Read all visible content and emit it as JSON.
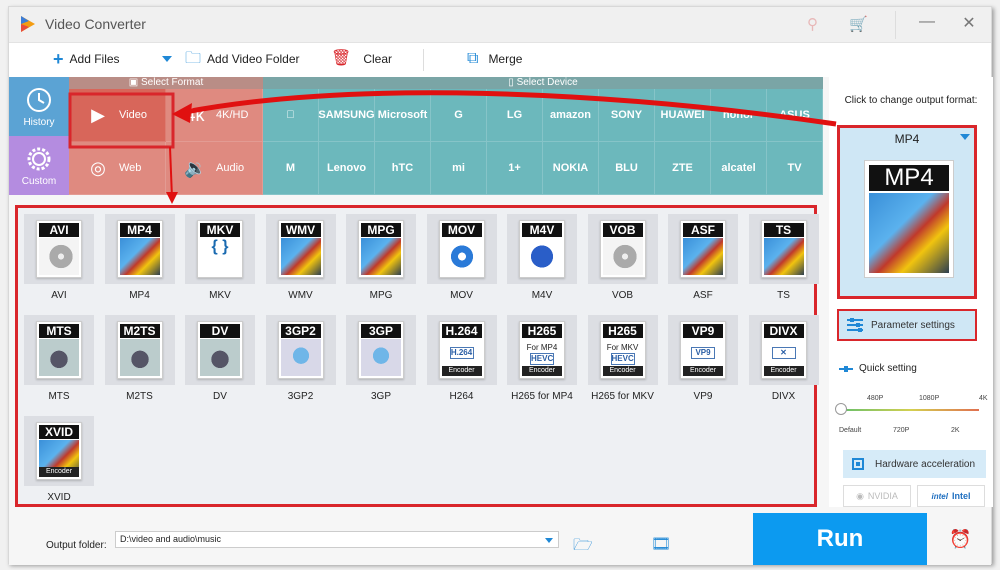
{
  "window": {
    "title": "Video Converter",
    "controls": {
      "minimize": "—",
      "close": "✕"
    },
    "title_icons": [
      {
        "name": "key-icon",
        "glyph": "⚷"
      },
      {
        "name": "cart-icon",
        "glyph": "⧢"
      }
    ]
  },
  "toolbar": {
    "add_files": "Add Files",
    "add_video_folder": "Add Video Folder",
    "clear": "Clear",
    "merge": "Merge"
  },
  "side": {
    "history": "History",
    "custom": "Custom"
  },
  "format_panel": {
    "header": "Select Format",
    "categories": [
      {
        "label": "Video",
        "icon": "play-icon",
        "glyph": "▶",
        "active": true
      },
      {
        "label": "4K/HD",
        "icon": "4k-icon",
        "glyph": "4k"
      },
      {
        "label": "Web",
        "icon": "chrome-icon",
        "glyph": "◎"
      },
      {
        "label": "Audio",
        "icon": "speaker-icon",
        "glyph": "🔉"
      }
    ]
  },
  "device_panel": {
    "header": "Select Device",
    "row1": [
      "",
      "SAMSUNG",
      "Microsoft",
      "G",
      "LG",
      "amazon",
      "SONY",
      "HUAWEI",
      "honor",
      "ASUS"
    ],
    "row1_names": [
      "apple",
      "samsung",
      "microsoft",
      "google",
      "lg",
      "amazon",
      "sony",
      "huawei",
      "honor",
      "asus"
    ],
    "row2": [
      "M",
      "Lenovo",
      "hTC",
      "mi",
      "1+",
      "NOKIA",
      "BLU",
      "ZTE",
      "alcatel",
      "TV"
    ],
    "row2_names": [
      "motorola",
      "lenovo",
      "htc",
      "xiaomi",
      "oneplus",
      "nokia",
      "blu",
      "zte",
      "alcatel",
      "tv"
    ]
  },
  "formats": [
    {
      "label": "AVI",
      "tag": "AVI",
      "art": "disc"
    },
    {
      "label": "MP4",
      "tag": "MP4",
      "art": "film"
    },
    {
      "label": "MKV",
      "tag": "MKV",
      "art": "mkv"
    },
    {
      "label": "WMV",
      "tag": "WMV",
      "art": "film"
    },
    {
      "label": "MPG",
      "tag": "MPG",
      "art": "film"
    },
    {
      "label": "MOV",
      "tag": "MOV",
      "art": "qt"
    },
    {
      "label": "M4V",
      "tag": "M4V",
      "art": "itunes"
    },
    {
      "label": "VOB",
      "tag": "VOB",
      "art": "disc"
    },
    {
      "label": "ASF",
      "tag": "ASF",
      "art": "film"
    },
    {
      "label": "TS",
      "tag": "TS",
      "art": "film"
    },
    {
      "label": "MTS",
      "tag": "MTS",
      "art": "cam"
    },
    {
      "label": "M2TS",
      "tag": "M2TS",
      "art": "cam"
    },
    {
      "label": "DV",
      "tag": "DV",
      "art": "cam"
    },
    {
      "label": "3GP2",
      "tag": "3GP2",
      "art": "phone"
    },
    {
      "label": "3GP",
      "tag": "3GP",
      "art": "phone"
    },
    {
      "label": "H264",
      "tag": "H.264",
      "art": "enc",
      "box": "H.264",
      "encoder": "Encoder"
    },
    {
      "label": "H265 for MP4",
      "tag": "H265",
      "art": "enc",
      "sub": "For MP4",
      "box": "HEVC",
      "encoder": "Encoder"
    },
    {
      "label": "H265 for MKV",
      "tag": "H265",
      "art": "enc",
      "sub": "For MKV",
      "box": "HEVC",
      "encoder": "Encoder"
    },
    {
      "label": "VP9",
      "tag": "VP9",
      "art": "enc",
      "box": "VP9",
      "encoder": "Encoder"
    },
    {
      "label": "DIVX",
      "tag": "DIVX",
      "art": "enc",
      "box": "✕",
      "encoder": "Encoder"
    },
    {
      "label": "XVID",
      "tag": "XVID",
      "art": "film",
      "encoder": "Encoder"
    }
  ],
  "right_panel": {
    "hint": "Click to change output format:",
    "output_format": "MP4",
    "parameter_settings": "Parameter settings",
    "quick_setting": "Quick setting",
    "slider": {
      "top_ticks": [
        "480P",
        "1080P",
        "4K"
      ],
      "bottom_ticks": [
        "Default",
        "720P",
        "2K"
      ],
      "value": "Default"
    },
    "hardware_acceleration": "Hardware acceleration",
    "nvidia": "NVIDIA",
    "intel": "Intel"
  },
  "bottom": {
    "output_folder_label": "Output folder:",
    "output_folder_value": "D:\\video and audio\\music",
    "run": "Run"
  },
  "colors": {
    "accent": "#0c9af0",
    "format_bg": "#df8a80",
    "device_bg": "#6cb8bc",
    "annotation": "#d9262b"
  }
}
